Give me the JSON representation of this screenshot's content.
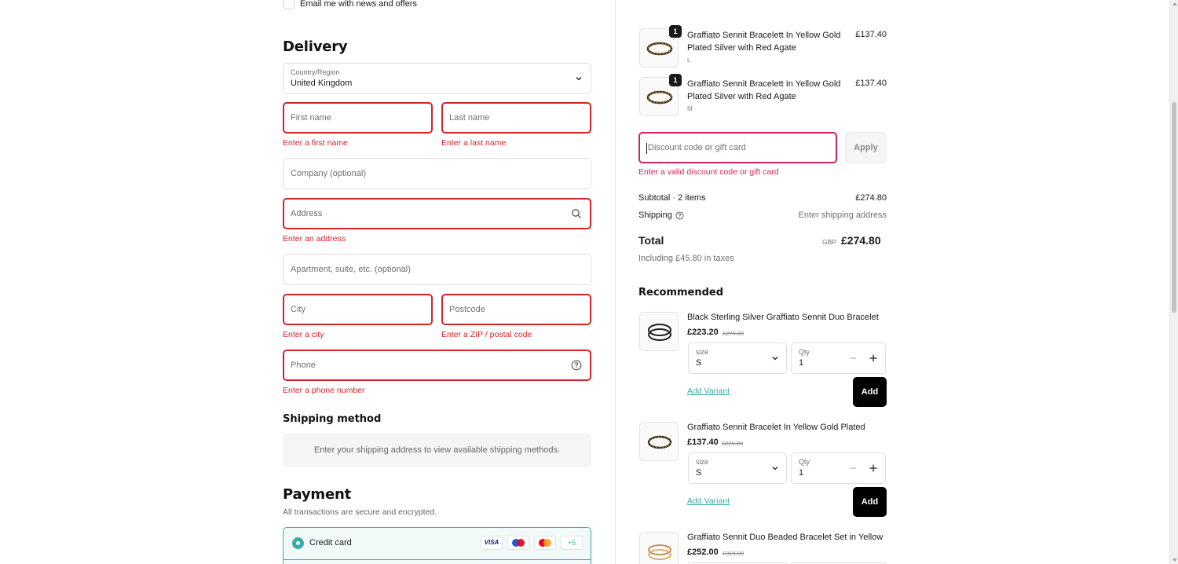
{
  "contact": {
    "email_news_label": "Email me with news and offers"
  },
  "delivery": {
    "heading": "Delivery",
    "country_label": "Country/Region",
    "country_value": "United Kingdom",
    "first_name_placeholder": "First name",
    "first_name_error": "Enter a first name",
    "last_name_placeholder": "Last name",
    "last_name_error": "Enter a last name",
    "company_placeholder": "Company (optional)",
    "address_placeholder": "Address",
    "address_error": "Enter an address",
    "apartment_placeholder": "Apartment, suite, etc. (optional)",
    "city_placeholder": "City",
    "city_error": "Enter a city",
    "postcode_placeholder": "Postcode",
    "postcode_error": "Enter a ZIP / postal code",
    "phone_placeholder": "Phone",
    "phone_error": "Enter a phone number"
  },
  "shipping_method": {
    "heading": "Shipping method",
    "info": "Enter your shipping address to view available shipping methods."
  },
  "payment": {
    "heading": "Payment",
    "subtitle": "All transactions are secure and encrypted.",
    "credit_card_label": "Credit card",
    "card_logos": [
      "VISA",
      "Maestro",
      "Mastercard"
    ],
    "more_cards": "+5"
  },
  "order": {
    "items": [
      {
        "quantity": "1",
        "title_line1": "Graffiato Sennit Bracelett In Yellow Gold",
        "title_line2": "Plated Silver with Red Agate",
        "variant": "L",
        "price": "£137.40"
      },
      {
        "quantity": "1",
        "title_line1": "Graffiato Sennit Bracelett In Yellow Gold",
        "title_line2": "Plated Silver with Red Agate",
        "variant": "M",
        "price": "£137.40"
      }
    ],
    "discount_placeholder": "Discount code or gift card",
    "apply_label": "Apply",
    "discount_error": "Enter a valid discount code or gift card",
    "subtotal_label": "Subtotal · 2 items",
    "subtotal_value": "£274.80",
    "shipping_label": "Shipping",
    "shipping_value": "Enter shipping address",
    "total_label": "Total",
    "total_currency": "GBP",
    "total_value": "£274.80",
    "taxes_note": "Including £45.80 in taxes"
  },
  "recommended": {
    "heading": "Recommended",
    "items": [
      {
        "title": "Black Sterling Silver Graffiato Sennit Duo Bracelet",
        "price": "£223.20",
        "compare_price": "£279.00",
        "size_label": "size",
        "size_value": "S",
        "qty_label": "Qty",
        "qty_value": "1",
        "add_variant": "Add Variant",
        "add_label": "Add"
      },
      {
        "title": "Graffiato Sennit Bracelet In Yellow Gold Plated",
        "price": "£137.40",
        "compare_price": "£229.00",
        "size_label": "size",
        "size_value": "S",
        "qty_label": "Qty",
        "qty_value": "1",
        "add_variant": "Add Variant",
        "add_label": "Add"
      },
      {
        "title": "Graffiato Sennit Duo Beaded Bracelet Set in Yellow",
        "price": "£252.00",
        "compare_price": "£315.00"
      }
    ]
  },
  "colors": {
    "error": "#d0242b",
    "discount_error": "#d0245e",
    "accent": "#3aaba6",
    "button": "#000000"
  }
}
